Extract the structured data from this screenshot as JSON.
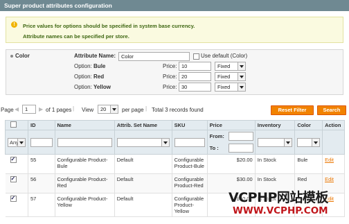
{
  "header": {
    "title": "Super product attributes configuration"
  },
  "notice": {
    "icon": "info-icon",
    "lines": [
      "Price values for options should be specified in system base currency.",
      "Attribute names can be specified per store."
    ]
  },
  "attribute": {
    "name": "Color",
    "name_label": "Attribute Name:",
    "name_value": "Color",
    "use_default_label": "Use default (Color)",
    "options": [
      {
        "prefix": "Option:",
        "name": "Bule",
        "price_label": "Price:",
        "price": "10",
        "type": "Fixed"
      },
      {
        "prefix": "Option:",
        "name": "Red",
        "price_label": "Price:",
        "price": "20",
        "type": "Fixed"
      },
      {
        "prefix": "Option:",
        "name": "Yellow",
        "price_label": "Price:",
        "price": "30",
        "type": "Fixed"
      }
    ]
  },
  "pager": {
    "page_label": "Page",
    "page_value": "1",
    "of_pages": "of 1 pages",
    "view_label": "View",
    "per_page_value": "20",
    "per_page_label": "per page",
    "total": "Total 3 records found",
    "reset_label": "Reset Filter",
    "search_label": "Search"
  },
  "grid": {
    "columns": [
      "ID",
      "Name",
      "Attrib. Set Name",
      "SKU",
      "Price",
      "Inventory",
      "Color",
      "Action"
    ],
    "filter": {
      "any": "Any",
      "from": "From:",
      "to": "To :"
    },
    "rows": [
      {
        "id": "55",
        "name": "Configurable Product-Bule",
        "set": "Default",
        "sku": "Configurable Product-Bule",
        "price": "$20.00",
        "inventory": "In Stock",
        "color": "Bule",
        "action": "Edit"
      },
      {
        "id": "56",
        "name": "Configurable Product-Red",
        "set": "Default",
        "sku": "Configurable Product-Red",
        "price": "$30.00",
        "inventory": "In Stock",
        "color": "Red",
        "action": "Edit"
      },
      {
        "id": "57",
        "name": "Configurable Product-Yellow",
        "set": "Default",
        "sku": "Configurable Product-Yellow",
        "price": "$40.00",
        "inventory": "In Stock",
        "color": "Yellow",
        "action": "Edit"
      }
    ]
  },
  "watermark": {
    "line1": "VCPHP网站模板",
    "line2": "WWW.VCPHP.COM"
  },
  "colors": {
    "header_bg": "#6f8992",
    "button_orange": "#f18200",
    "notice_text": "#3d6611",
    "watermark_red": "#c0161b"
  }
}
